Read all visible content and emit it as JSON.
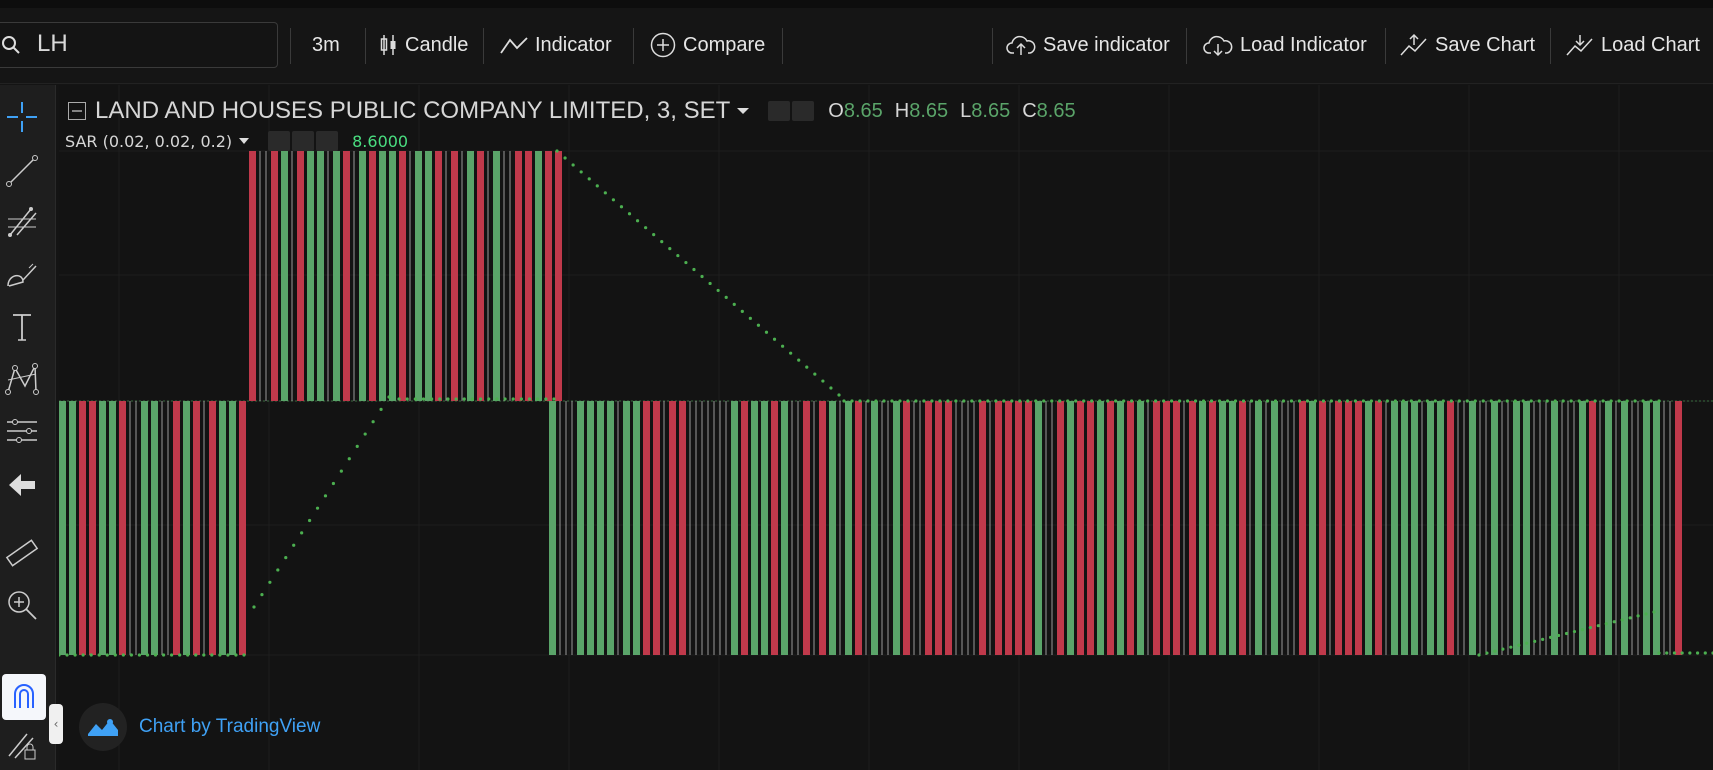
{
  "toolbar": {
    "search_value": "LH",
    "interval": "3m",
    "chart_type": "Candle",
    "indicator": "Indicator",
    "compare": "Compare",
    "save_indicator": "Save indicator",
    "load_indicator": "Load Indicator",
    "save_chart": "Save Chart",
    "load_chart": "Load Chart"
  },
  "left_tools": [
    "crosshair-icon",
    "trend-line-icon",
    "fib-icon",
    "brush-icon",
    "text-icon",
    "pattern-icon",
    "measure-icon",
    "back-arrow-icon",
    "ruler-icon",
    "zoom-in-icon",
    "magnet-icon",
    "lock-draw-icon"
  ],
  "legend": {
    "symbol": "LAND AND HOUSES PUBLIC COMPANY LIMITED, 3, SET",
    "o_label": "O",
    "o_value": "8.65",
    "h_label": "H",
    "h_value": "8.65",
    "l_label": "L",
    "l_value": "8.65",
    "c_label": "C",
    "c_value": "8.65"
  },
  "sar": {
    "label": "SAR (0.02, 0.02, 0.2)",
    "value": "8.6000"
  },
  "watermark": "Chart by TradingView",
  "colors": {
    "up": "#5aa469",
    "down": "#c0394b",
    "sar": "#4caf50",
    "bg": "#131313",
    "accent": "#3fa1f5"
  },
  "chart_data": {
    "type": "candlestick",
    "levels": {
      "upper": 8.65,
      "middle": 8.6,
      "lower": 8.55
    },
    "segments": [
      {
        "from_bar": 0,
        "to_bar": 38,
        "range": "middle-lower"
      },
      {
        "from_bar": 39,
        "to_bar": 100,
        "range": "upper-middle"
      },
      {
        "from_bar": 101,
        "to_bar": 300,
        "range": "middle-lower"
      }
    ]
  }
}
